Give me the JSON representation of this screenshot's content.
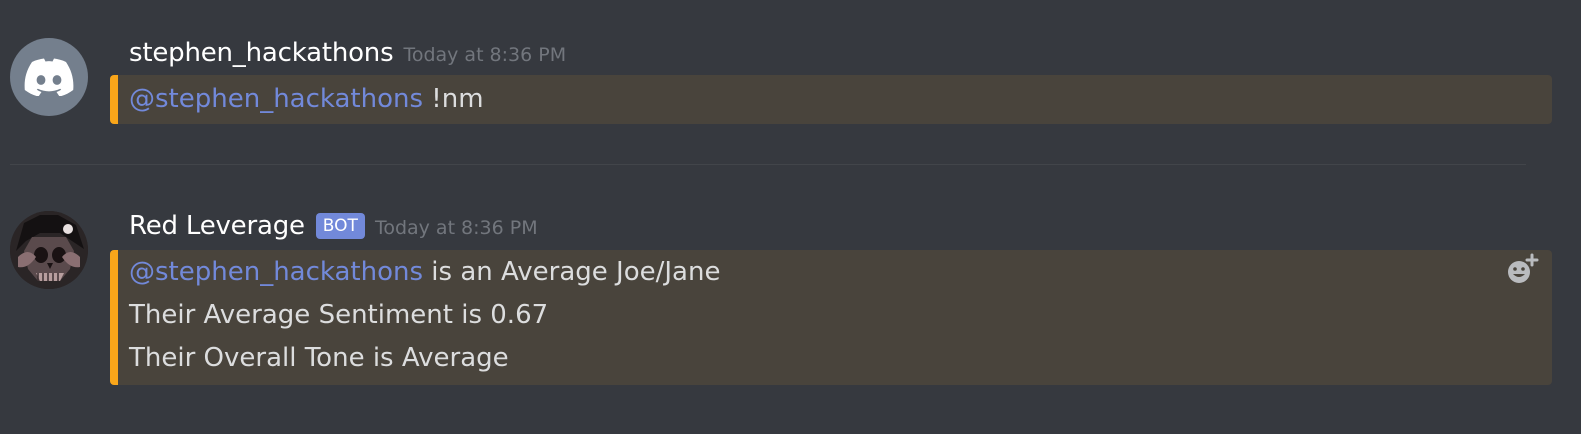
{
  "messages": [
    {
      "author": "stephen_hackathons",
      "timestamp": "Today at 8:36 PM",
      "avatar_icon": "discord-logo-icon",
      "lines": [
        {
          "mention": "@stephen_hackathons",
          "text": " !nm"
        }
      ]
    },
    {
      "author": "Red Leverage",
      "bot_tag": "BOT",
      "timestamp": "Today at 8:36 PM",
      "avatar_icon": "skull-avatar",
      "lines": [
        {
          "mention": "@stephen_hackathons",
          "text": " is an Average Joe/Jane"
        },
        {
          "text": "Their Average Sentiment is 0.67"
        },
        {
          "text": "Their Overall Tone is Average"
        }
      ],
      "reaction_icon": "add-reaction-icon"
    }
  ],
  "colors": {
    "background": "#36393f",
    "mention": "#7289da",
    "highlight_bg": "#49443c",
    "highlight_border": "#faa61a",
    "bot_tag": "#7289da",
    "timestamp": "#72767d"
  }
}
